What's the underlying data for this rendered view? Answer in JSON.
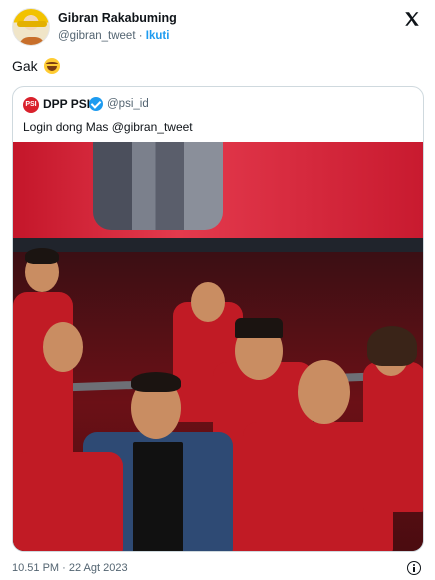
{
  "tweet": {
    "author": {
      "name": "Gibran Rakabuming",
      "handle": "@gibran_tweet",
      "separator": "·",
      "follow_label": "Ikuti"
    },
    "text": "Gak",
    "emoji": "face-with-tears-of-joy-icon",
    "timestamp": "10.51 PM · 22 Agt 2023"
  },
  "quoted": {
    "name": "DPP PSI",
    "handle": "@psi_id",
    "text": "Login dong Mas @gibran_tweet",
    "logo_text": "PSI"
  },
  "colors": {
    "accent": "#1d9bf0",
    "psi_red": "#d9212c",
    "text": "#0f1419",
    "muted": "#536471"
  }
}
